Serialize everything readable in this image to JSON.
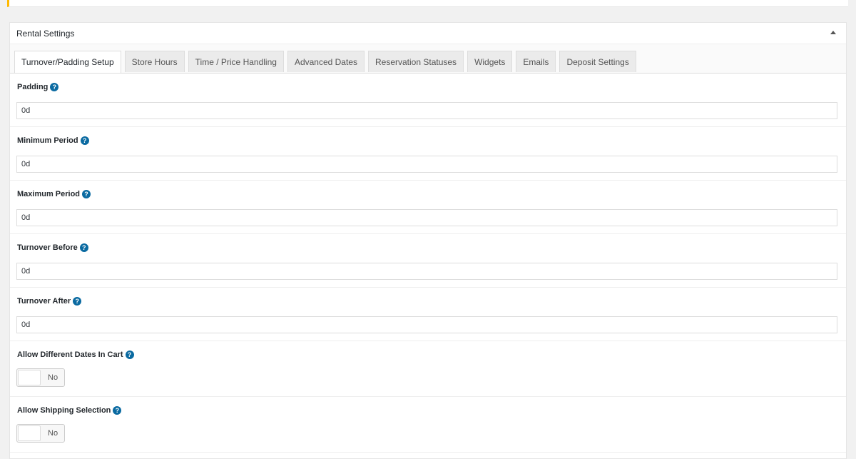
{
  "panel": {
    "title": "Rental Settings"
  },
  "tabs": [
    {
      "label": "Turnover/Padding Setup",
      "active": true
    },
    {
      "label": "Store Hours"
    },
    {
      "label": "Time / Price Handling"
    },
    {
      "label": "Advanced Dates"
    },
    {
      "label": "Reservation Statuses"
    },
    {
      "label": "Widgets"
    },
    {
      "label": "Emails"
    },
    {
      "label": "Deposit Settings"
    }
  ],
  "fields": {
    "padding": {
      "label": "Padding",
      "value": "0d"
    },
    "minimum_period": {
      "label": "Minimum Period",
      "value": "0d"
    },
    "maximum_period": {
      "label": "Maximum Period",
      "value": "0d"
    },
    "turnover_before": {
      "label": "Turnover Before",
      "value": "0d"
    },
    "turnover_after": {
      "label": "Turnover After",
      "value": "0d"
    }
  },
  "toggles": {
    "allow_different_dates": {
      "label": "Allow Different Dates In Cart",
      "value": "No"
    },
    "allow_shipping_selection": {
      "label": "Allow Shipping Selection",
      "value": "No"
    }
  },
  "help_glyph": "?",
  "colors": {
    "notice_accent": "#ffb900",
    "help_icon": "#0a6aa1"
  }
}
